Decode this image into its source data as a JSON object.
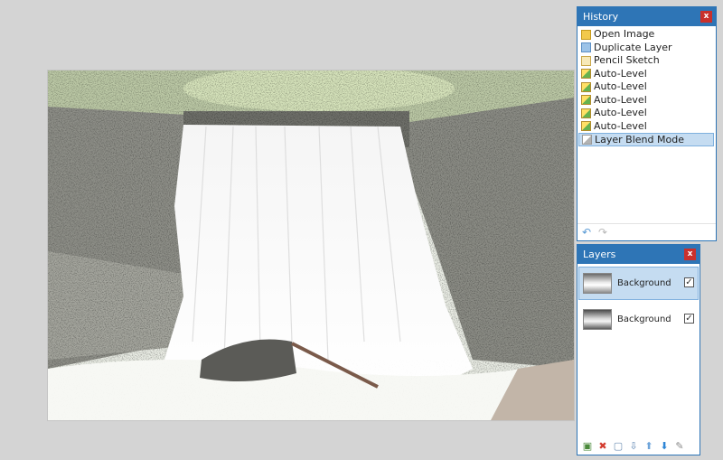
{
  "history": {
    "title": "History",
    "close_label": "x",
    "items": [
      {
        "label": "Open Image",
        "icon": "open-image-icon"
      },
      {
        "label": "Duplicate Layer",
        "icon": "duplicate-layer-icon"
      },
      {
        "label": "Pencil Sketch",
        "icon": "pencil-sketch-icon"
      },
      {
        "label": "Auto-Level",
        "icon": "auto-level-icon"
      },
      {
        "label": "Auto-Level",
        "icon": "auto-level-icon"
      },
      {
        "label": "Auto-Level",
        "icon": "auto-level-icon"
      },
      {
        "label": "Auto-Level",
        "icon": "auto-level-icon"
      },
      {
        "label": "Auto-Level",
        "icon": "auto-level-icon"
      },
      {
        "label": "Layer Blend Mode",
        "icon": "blend-mode-icon"
      }
    ],
    "undo_icon": "↶",
    "redo_icon": "↷"
  },
  "layers": {
    "title": "Layers",
    "close_label": "x",
    "items": [
      {
        "name": "Background",
        "visible_mark": "✓"
      },
      {
        "name": "Background",
        "visible_mark": "✓"
      }
    ],
    "toolbar": {
      "add": "▣",
      "delete": "✖",
      "duplicate": "▢",
      "merge": "⇩",
      "move_up": "⬆",
      "move_down": "⬇",
      "properties": "✎"
    }
  },
  "colors": {
    "panel_title": "#2e75b6",
    "selection": "#c5dcf1",
    "close": "#c9302c",
    "workspace": "#d4d4d4"
  }
}
